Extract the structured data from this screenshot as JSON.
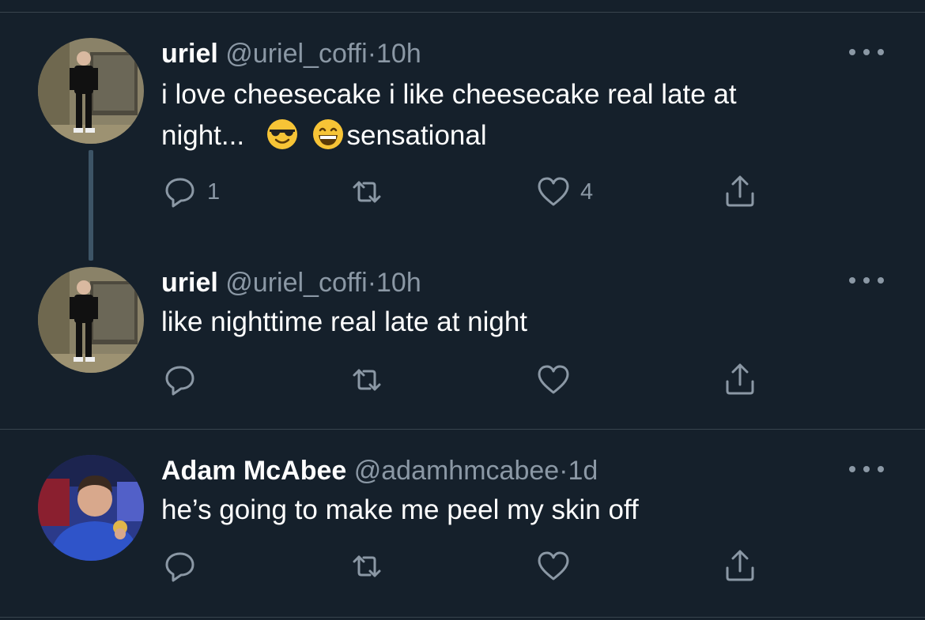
{
  "colors": {
    "background": "#15202b",
    "divider": "#38444d",
    "secondary_text": "#8b98a5",
    "thread_line": "#3d5466"
  },
  "tweets": [
    {
      "name": "uriel",
      "handle": "@uriel_coffi",
      "separator": "·",
      "time": "10h",
      "text_line1": "i love cheesecake i like cheesecake real late at",
      "text_line2_start": "night...",
      "emojis": [
        "smiling-face-with-sunglasses",
        "grinning-face-with-smiling-eyes"
      ],
      "text_line2_end": "sensational",
      "reply_count": "1",
      "retweet_count": "",
      "like_count": "4"
    },
    {
      "name": "uriel",
      "handle": "@uriel_coffi",
      "separator": "·",
      "time": "10h",
      "text": "like nighttime real late at night",
      "reply_count": "",
      "retweet_count": "",
      "like_count": ""
    },
    {
      "name": "Adam McAbee",
      "handle": "@adamhmcabee",
      "separator": "·",
      "time": "1d",
      "text": "he’s going to make me peel my skin off",
      "reply_count": "",
      "retweet_count": "",
      "like_count": ""
    }
  ],
  "icons": {
    "reply": "reply-icon",
    "retweet": "retweet-icon",
    "like": "heart-icon",
    "share": "share-icon",
    "more": "more-icon"
  }
}
